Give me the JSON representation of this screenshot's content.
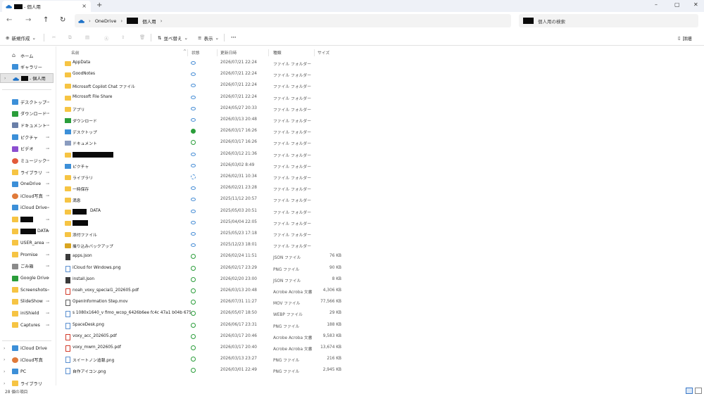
{
  "window": {
    "tab_title": "- 個人用",
    "tab_close": "×",
    "new_tab": "+",
    "minimize": "–",
    "maximize": "▢",
    "close": "✕"
  },
  "addressbar": {
    "crumbs": [
      "OneDrive",
      "個人用"
    ],
    "separator": "›",
    "search_placeholder": "個人用の検索"
  },
  "toolbar": {
    "new_label": "新規作成",
    "sort_label": "並べ替え",
    "view_label": "表示",
    "more_label": "···",
    "details_label": "詳細"
  },
  "sidebar": {
    "home": "ホーム",
    "gallery": "ギャラリー",
    "current": "- 個人用",
    "quick": [
      {
        "label": "デスクトップ",
        "icon": "desktop-icon",
        "color": "#3c8fd8"
      },
      {
        "label": "ダウンロード",
        "icon": "download-icon",
        "color": "#2a9d3a"
      },
      {
        "label": "ドキュメント",
        "icon": "document-icon",
        "color": "#6a7fa8"
      },
      {
        "label": "ピクチャ",
        "icon": "pictures-icon",
        "color": "#3c8fd8"
      },
      {
        "label": "ビデオ",
        "icon": "video-icon",
        "color": "#8c4fd0"
      },
      {
        "label": "ミュージック",
        "icon": "music-icon",
        "color": "#e25a3a"
      },
      {
        "label": "ライブラリ",
        "icon": "folder-icon",
        "color": "#f6c443"
      },
      {
        "label": "OneDrive",
        "icon": "cloud-icon",
        "color": "#3c8fd8"
      },
      {
        "label": "iCloud写真",
        "icon": "icloud-photos-icon",
        "color": "#e07a3a"
      },
      {
        "label": "iCloud Drive",
        "icon": "icloud-drive-icon",
        "color": "#3c8fd8"
      },
      {
        "label": "",
        "icon": "folder-icon",
        "color": "#f6c443"
      },
      {
        "label": "DATA",
        "icon": "folder-icon",
        "color": "#f6c443"
      },
      {
        "label": "USER_area",
        "icon": "folder-icon",
        "color": "#f6c443"
      },
      {
        "label": "Promise",
        "icon": "folder-icon",
        "color": "#f6c443"
      },
      {
        "label": "ごみ箱",
        "icon": "recycle-bin-icon",
        "color": "#8a8a8a"
      },
      {
        "label": "Google Drive",
        "icon": "google-drive-icon",
        "color": "#2a9d3a"
      },
      {
        "label": "Screenshots",
        "icon": "folder-icon",
        "color": "#f6c443"
      },
      {
        "label": "SlideShow",
        "icon": "folder-icon",
        "color": "#f6c443"
      },
      {
        "label": "iniShield",
        "icon": "folder-icon",
        "color": "#f6c443"
      },
      {
        "label": "Captures",
        "icon": "folder-icon",
        "color": "#f6c443"
      }
    ],
    "bottom": [
      {
        "label": "iCloud Drive",
        "icon": "icloud-drive-icon",
        "color": "#3c8fd8"
      },
      {
        "label": "iCloud写真",
        "icon": "icloud-photos-icon",
        "color": "#e07a3a"
      },
      {
        "label": "PC",
        "icon": "pc-icon",
        "color": "#3c8fd8"
      },
      {
        "label": "ライブラリ",
        "icon": "folder-icon",
        "color": "#f6c443"
      }
    ]
  },
  "columns": {
    "name": "名前",
    "status": "状態",
    "date": "更新日時",
    "type": "種類",
    "size": "サイズ"
  },
  "files": [
    {
      "name": "AppData",
      "kind": "folder",
      "status": "cloud",
      "date": "2026/07/21 22:24",
      "type": "ファイル フォルダー",
      "size": ""
    },
    {
      "name": "GoodNotes",
      "kind": "folder",
      "status": "cloud",
      "date": "2026/07/21 22:24",
      "type": "ファイル フォルダー",
      "size": ""
    },
    {
      "name": "Microsoft Copilot Chat ファイル",
      "kind": "folder",
      "status": "cloud",
      "date": "2026/07/21 22:24",
      "type": "ファイル フォルダー",
      "size": ""
    },
    {
      "name": "Microsoft File Share",
      "kind": "folder",
      "status": "cloud",
      "date": "2026/07/21 22:24",
      "type": "ファイル フォルダー",
      "size": ""
    },
    {
      "name": "アプリ",
      "kind": "folder",
      "status": "cloud",
      "date": "2024/05/27 20:33",
      "type": "ファイル フォルダー",
      "size": ""
    },
    {
      "name": "ダウンロード",
      "kind": "download",
      "status": "cloud",
      "date": "2026/03/13 20:48",
      "type": "ファイル フォルダー",
      "size": ""
    },
    {
      "name": "デスクトップ",
      "kind": "desktop",
      "status": "solid",
      "date": "2026/03/17 16:26",
      "type": "ファイル フォルダー",
      "size": ""
    },
    {
      "name": "ドキュメント",
      "kind": "document",
      "status": "ok",
      "date": "2026/03/17 16:26",
      "type": "ファイル フォルダー",
      "size": ""
    },
    {
      "name": "",
      "kind": "folder",
      "status": "cloud",
      "date": "2026/03/12 21:36",
      "type": "ファイル フォルダー",
      "size": ""
    },
    {
      "name": "ピクチャ",
      "kind": "pictures",
      "status": "cloud",
      "date": "2026/03/02 8:49",
      "type": "ファイル フォルダー",
      "size": ""
    },
    {
      "name": "ライブラリ",
      "kind": "folder",
      "status": "sync",
      "date": "2026/02/31 10:34",
      "type": "ファイル フォルダー",
      "size": ""
    },
    {
      "name": "一時保存",
      "kind": "folder",
      "status": "cloud",
      "date": "2026/02/21 23:28",
      "type": "ファイル フォルダー",
      "size": ""
    },
    {
      "name": "満息",
      "kind": "folder",
      "status": "cloud",
      "date": "2025/11/12 20:57",
      "type": "ファイル フォルダー",
      "size": ""
    },
    {
      "name": "DATA",
      "kind": "folder",
      "status": "cloud",
      "date": "2025/05/03 20:51",
      "type": "ファイル フォルダー",
      "size": ""
    },
    {
      "name": "",
      "kind": "folder",
      "status": "cloud",
      "date": "2025/04/04 22:05",
      "type": "ファイル フォルダー",
      "size": ""
    },
    {
      "name": "添付ファイル",
      "kind": "folder",
      "status": "cloud",
      "date": "2025/05/23 17:18",
      "type": "ファイル フォルダー",
      "size": ""
    },
    {
      "name": "撮り込みバックアップ",
      "kind": "folder-dark",
      "status": "cloud",
      "date": "2025/12/23 18:01",
      "type": "ファイル フォルダー",
      "size": ""
    },
    {
      "name": "apps.json",
      "kind": "json",
      "status": "ok",
      "date": "2026/02/24 11:51",
      "type": "JSON ファイル",
      "size": "76 KB"
    },
    {
      "name": "iCloud for Windows.png",
      "kind": "img",
      "status": "ok",
      "date": "2026/02/17 23:29",
      "type": "PNG ファイル",
      "size": "90 KB"
    },
    {
      "name": "install.json",
      "kind": "json",
      "status": "ok",
      "date": "2026/02/20 23:00",
      "type": "JSON ファイル",
      "size": "8 KB"
    },
    {
      "name": "noah_voxy_special1_202605.pdf",
      "kind": "pdf",
      "status": "ok",
      "date": "2026/03/13 20:48",
      "type": "Acrobe Acroba 文書",
      "size": "4,306 KB"
    },
    {
      "name": "OpenInformation Step.mov",
      "kind": "mov",
      "status": "ok",
      "date": "2026/07/31 11:27",
      "type": "MOV ファイル",
      "size": "77,566 KB"
    },
    {
      "name": "s 1080x1640_v fimo_wcop_6426b6ee fc4c 47a1 b04b 675...",
      "kind": "img",
      "status": "ok",
      "date": "2026/05/07 18:50",
      "type": "WEBP ファイル",
      "size": "29 KB"
    },
    {
      "name": "SpaceDesk.png",
      "kind": "img",
      "status": "ok",
      "date": "2026/06/17 23:31",
      "type": "PNG ファイル",
      "size": "188 KB"
    },
    {
      "name": "voxy_acc_202605.pdf",
      "kind": "pdf",
      "status": "ok",
      "date": "2026/03/17 20:46",
      "type": "Acrobe Acroba 文書",
      "size": "9,583 KB"
    },
    {
      "name": "voxy_mwm_202605.pdf",
      "kind": "pdf",
      "status": "ok",
      "date": "2026/03/17 20:40",
      "type": "Acrobe Acroba 文書",
      "size": "13,674 KB"
    },
    {
      "name": "スイートノン追報.png",
      "kind": "img",
      "status": "ok",
      "date": "2026/03/13 23:27",
      "type": "PNG ファイル",
      "size": "216 KB"
    },
    {
      "name": "自作アイコン.png",
      "kind": "img",
      "status": "ok",
      "date": "2026/03/01 22:49",
      "type": "PNG ファイル",
      "size": "2,945 KB"
    }
  ],
  "statusbar": {
    "count": "28 個の項目"
  },
  "colors": {
    "accent": "#3a78c8",
    "folder": "#f6c443",
    "synced": "#2a9d3a",
    "cloud": "#4a8fd6"
  }
}
